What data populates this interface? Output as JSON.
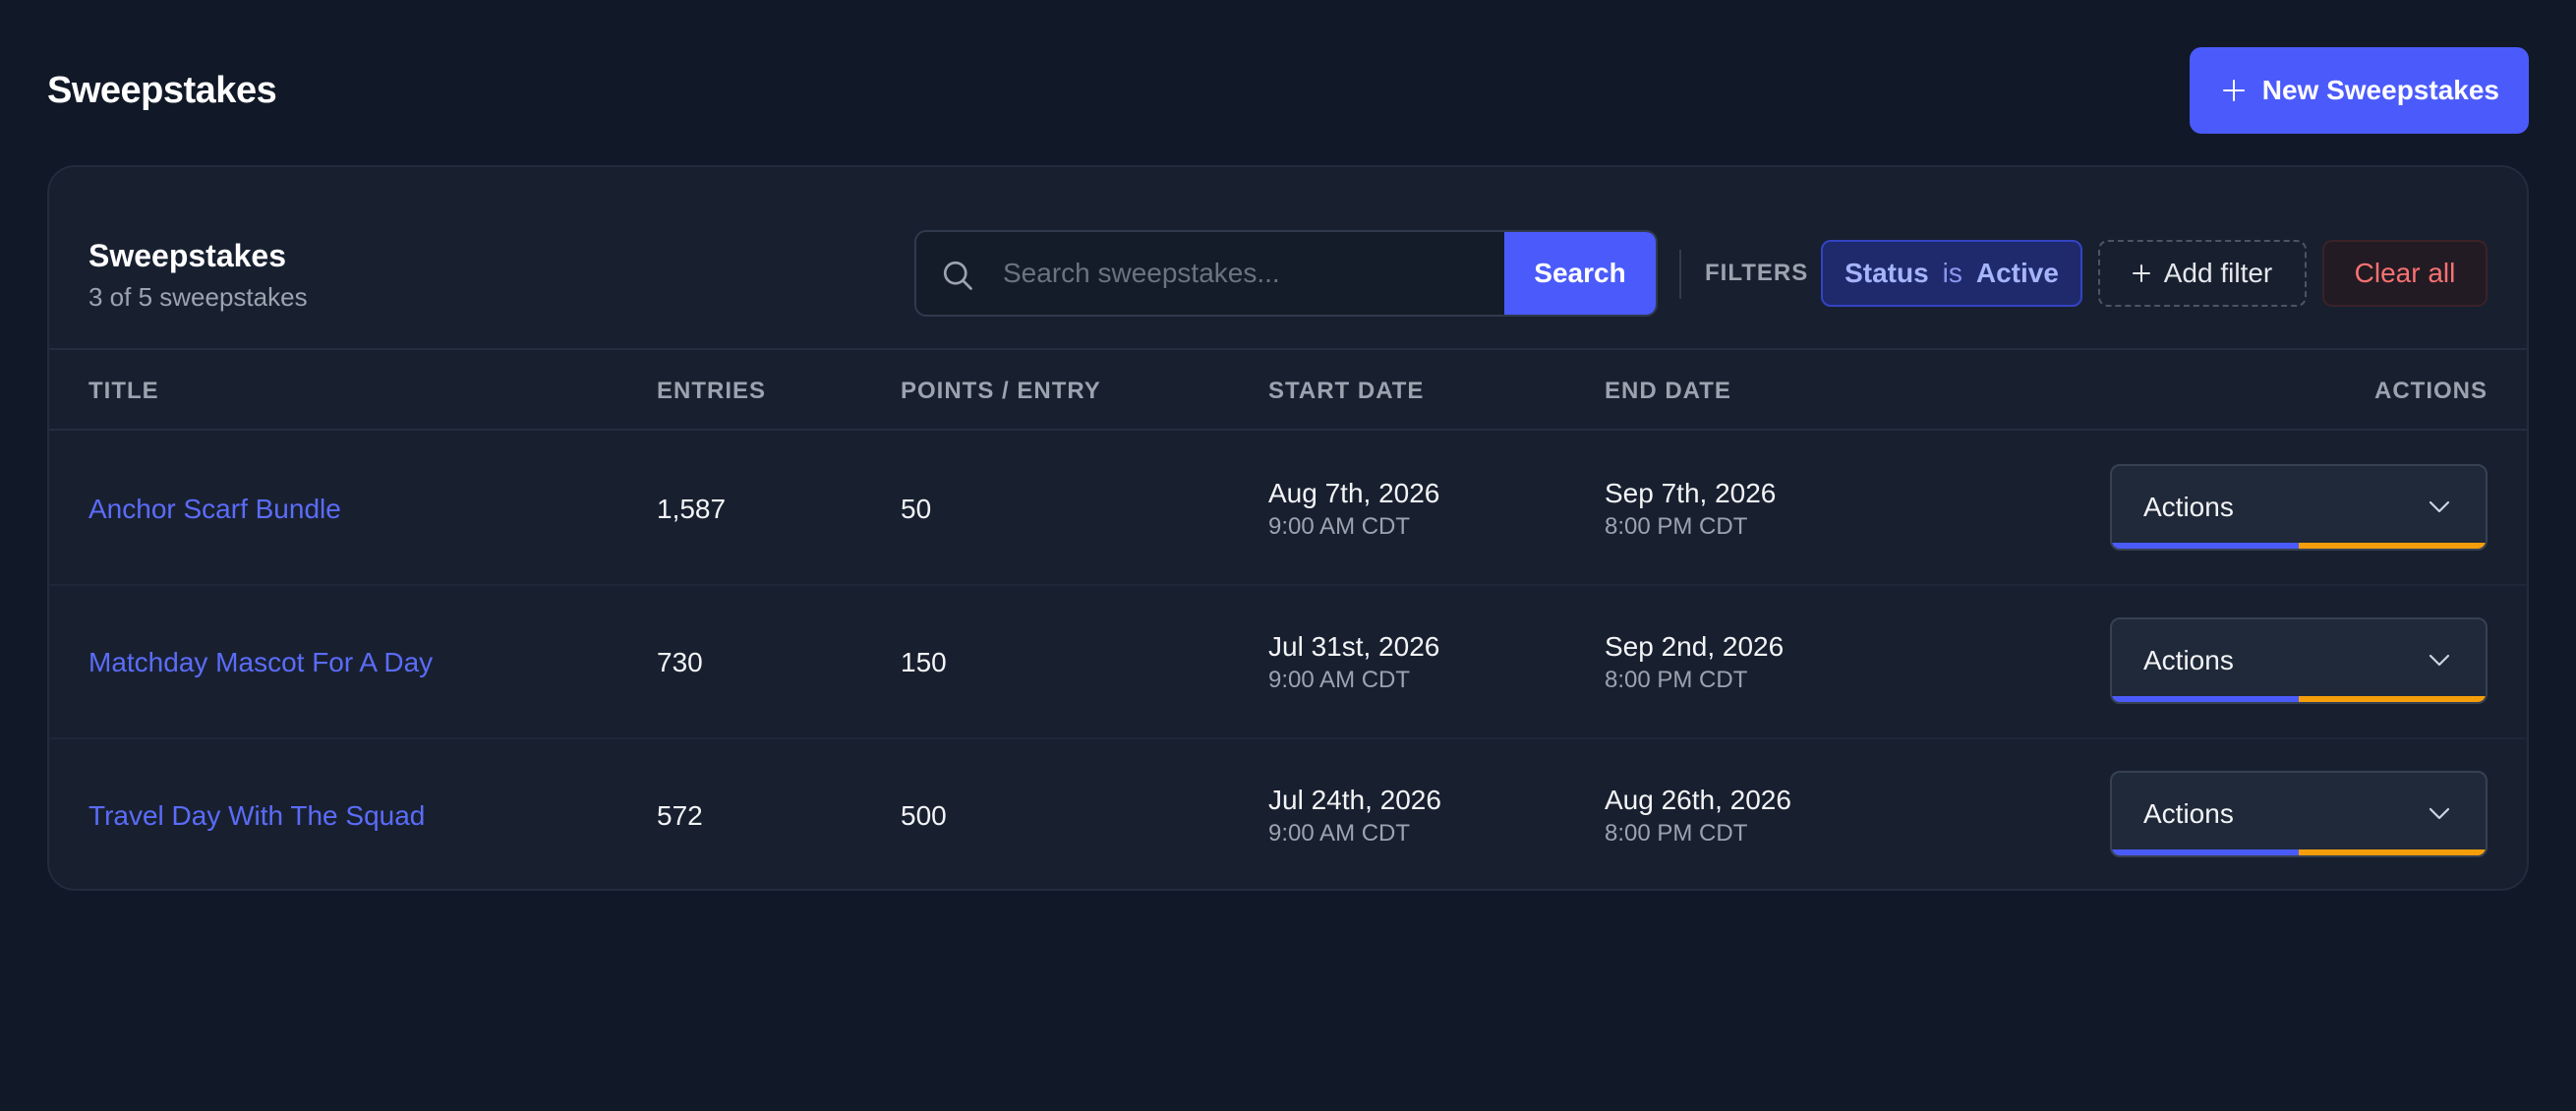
{
  "page": {
    "title": "Sweepstakes",
    "new_button_label": "New Sweepstakes"
  },
  "card": {
    "title": "Sweepstakes",
    "subtitle": "3 of 5 sweepstakes"
  },
  "search": {
    "placeholder": "Search sweepstakes...",
    "value": "",
    "button_label": "Search"
  },
  "filters": {
    "label": "FILTERS",
    "active": [
      {
        "field": "Status",
        "operator": "is",
        "value": "Active"
      }
    ],
    "add_label": "Add filter",
    "clear_label": "Clear all"
  },
  "table": {
    "columns": [
      "TITLE",
      "ENTRIES",
      "POINTS / ENTRY",
      "START DATE",
      "END DATE",
      "ACTIONS"
    ],
    "rows": [
      {
        "title": "Anchor Scarf Bundle",
        "entries": "1,587",
        "points_per_entry": "50",
        "start_date": "Aug 7th, 2026",
        "start_time": "9:00 AM CDT",
        "end_date": "Sep 7th, 2026",
        "end_time": "8:00 PM CDT",
        "actions_label": "Actions"
      },
      {
        "title": "Matchday Mascot For A Day",
        "entries": "730",
        "points_per_entry": "150",
        "start_date": "Jul 31st, 2026",
        "start_time": "9:00 AM CDT",
        "end_date": "Sep 2nd, 2026",
        "end_time": "8:00 PM CDT",
        "actions_label": "Actions"
      },
      {
        "title": "Travel Day With The Squad",
        "entries": "572",
        "points_per_entry": "500",
        "start_date": "Jul 24th, 2026",
        "start_time": "9:00 AM CDT",
        "end_date": "Aug 26th, 2026",
        "end_time": "8:00 PM CDT",
        "actions_label": "Actions"
      }
    ]
  },
  "colors": {
    "background": "#111827",
    "card": "#182030",
    "accent": "#4b5bfb",
    "link": "#5b6cf9",
    "warning_stripe": "#f59e0b",
    "danger": "#f87171"
  }
}
